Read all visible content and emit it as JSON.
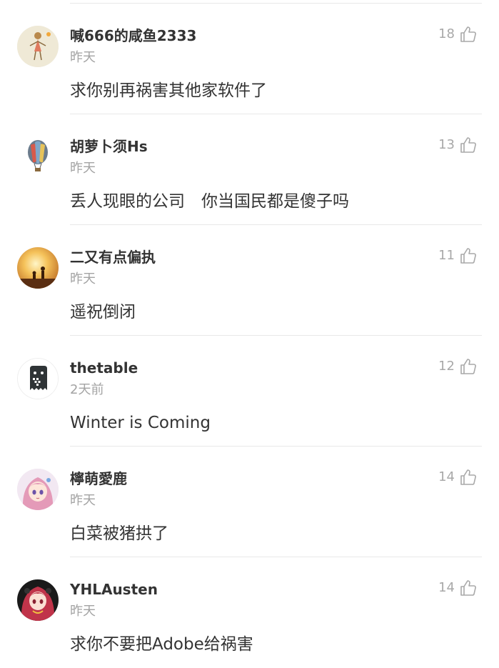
{
  "comments": [
    {
      "username": "喊666的咸鱼2333",
      "time": "昨天",
      "content": "求你别再祸害其他家软件了",
      "likes": "18",
      "avatar_icon": "sketch-figure-avatar"
    },
    {
      "username": "胡萝卜须Hs",
      "time": "昨天",
      "content": "丢人现眼的公司　你当国民都是傻子吗",
      "likes": "13",
      "avatar_icon": "hot-air-balloon-avatar"
    },
    {
      "username": "二又有点偏执",
      "time": "昨天",
      "content": "遥祝倒闭",
      "likes": "11",
      "avatar_icon": "sunset-silhouette-avatar"
    },
    {
      "username": "thetable",
      "time": "2天前",
      "content": "Winter is Coming",
      "likes": "12",
      "avatar_icon": "ghost-icon-avatar"
    },
    {
      "username": "檸萌愛鹿",
      "time": "昨天",
      "content": "白菜被猪拱了",
      "likes": "14",
      "avatar_icon": "anime-girl-avatar"
    },
    {
      "username": "YHLAusten",
      "time": "昨天",
      "content": "求你不要把Adobe给祸害",
      "likes": "14",
      "avatar_icon": "anime-girl-dark-avatar"
    }
  ],
  "colors": {
    "text_primary": "#333333",
    "text_secondary": "#a3a3a3",
    "divider": "#e8e8e8",
    "background": "#ffffff"
  }
}
